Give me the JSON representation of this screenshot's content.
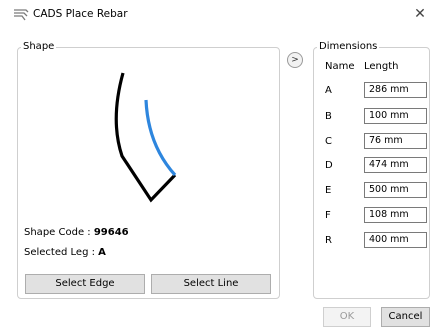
{
  "window": {
    "title": "CADS Place Rebar",
    "close_glyph": "✕",
    "app_icon": "rebar-shape-icon"
  },
  "shape_panel": {
    "group_label": "Shape",
    "shape_code_label": "Shape Code : ",
    "shape_code_value": "99646",
    "selected_leg_label": "Selected Leg : ",
    "selected_leg_value": "A",
    "select_edge_label": "Select Edge",
    "select_line_label": "Select Line",
    "colors": {
      "bar": "#000000",
      "highlight": "#2e86de"
    }
  },
  "expand_button": {
    "glyph": ">"
  },
  "dimensions_panel": {
    "group_label": "Dimensions",
    "header_name": "Name",
    "header_length": "Length",
    "rows": [
      {
        "name": "A",
        "length": "286 mm"
      },
      {
        "name": "B",
        "length": "100 mm"
      },
      {
        "name": "C",
        "length": "76 mm"
      },
      {
        "name": "D",
        "length": "474 mm"
      },
      {
        "name": "E",
        "length": "500 mm"
      },
      {
        "name": "F",
        "length": "108 mm"
      },
      {
        "name": "R",
        "length": "400 mm"
      }
    ]
  },
  "footer": {
    "ok_label": "OK",
    "cancel_label": "Cancel"
  }
}
